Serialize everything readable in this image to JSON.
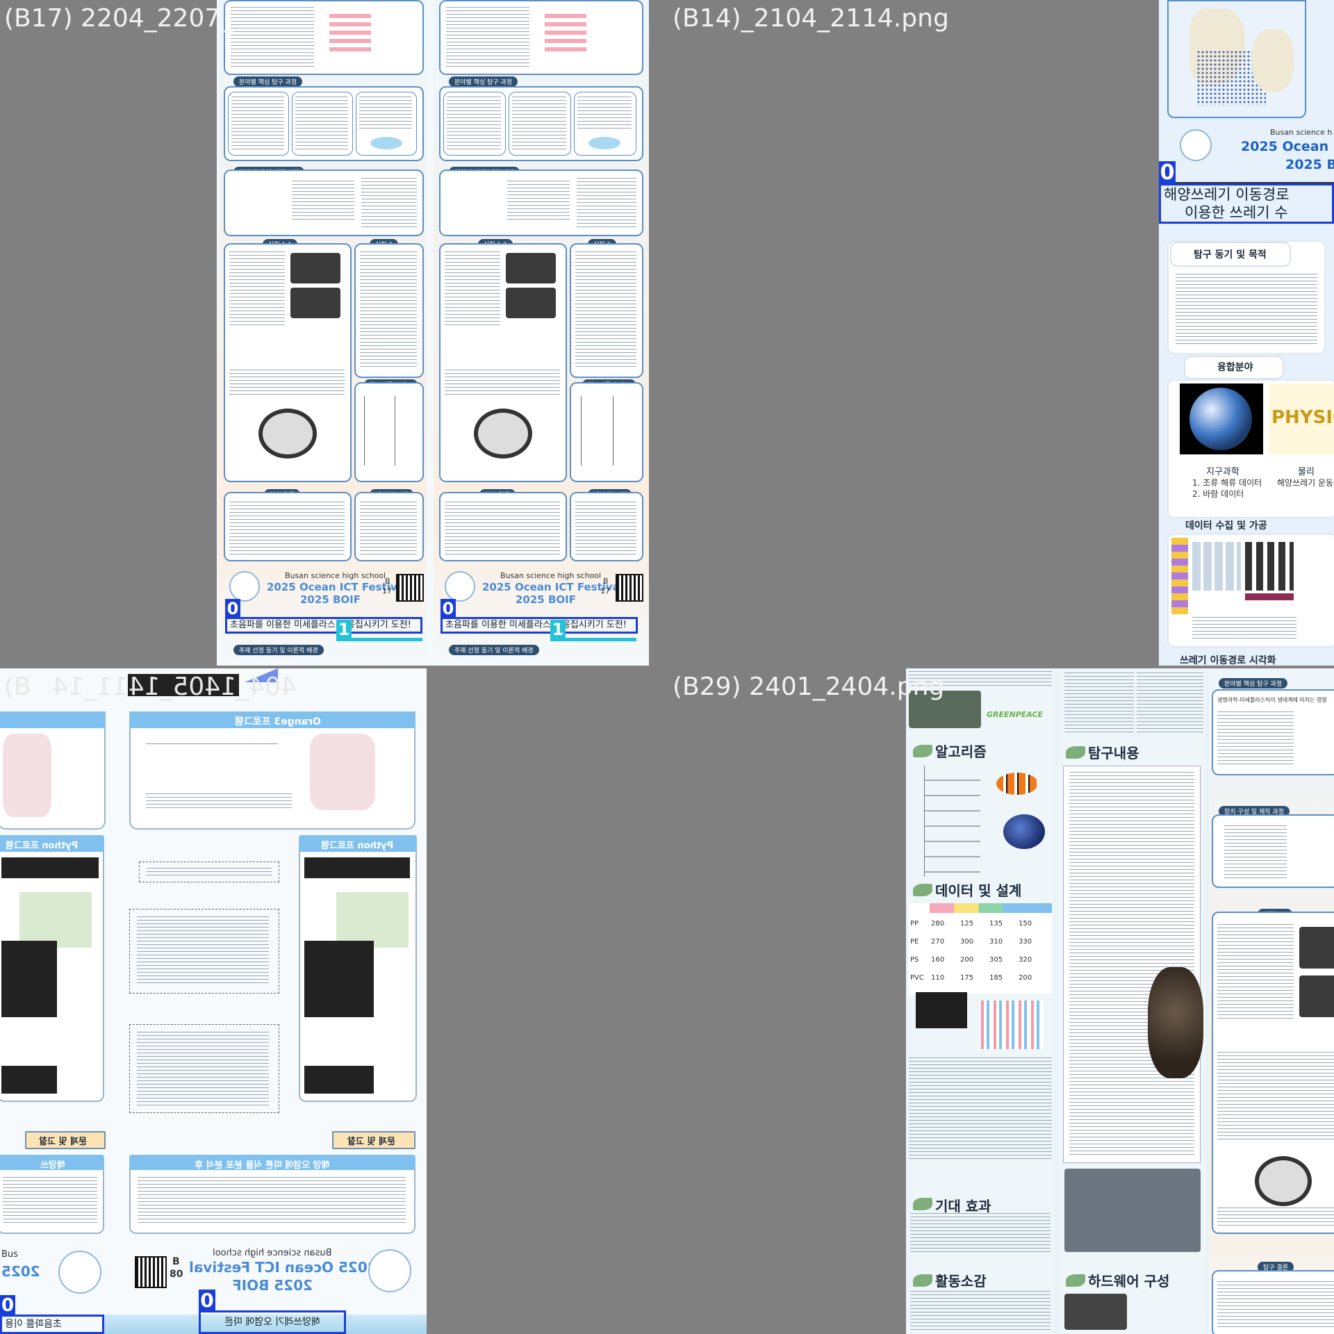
{
  "quadrants": {
    "tl": {
      "filename": "(B17) 2204_2207_",
      "school": "Busan science high school",
      "festival": "2025 Ocean ICT Festival",
      "boif": "2025 BOIF",
      "booth": "B",
      "booth_num": "17",
      "sections": [
        "분야별 핵심 탐구 과정",
        "장치 구성 및 제작 과정",
        "실험 1,2",
        "실험 3",
        "알고리즘 순서도",
        "탐구 결론",
        "제언 및 고찰",
        "주제 선정 동기 및 이론적 배경"
      ],
      "subpanels": [
        "생명과학-미세플라스틱이 생태계에 미치는 영향",
        "물리-미세플라스틱을 응집시키는 파동",
        "정보과학-응집장치 작동 방식 프로그래밍"
      ],
      "title_text": "초음파를 이용한 미세플라스틱 응집시키기 도전!",
      "title_text_cut": "초음파를 이용한 미세플라스",
      "title_text_tail": "응집시키기 도전!",
      "label0": "0",
      "label1": "1"
    },
    "tr": {
      "filename": "(B14)_2104_2114.png",
      "school": "Busan science h",
      "festival": "2025 Ocean I",
      "boif": "2025 B",
      "title_line1": "해양쓰레기 이동경로",
      "title_line2": "이용한 쓰레기 수",
      "section_motive": "탐구 동기 및 목적",
      "section_fusion": "융합분야",
      "earth_caption": "지구과학",
      "earth_items": [
        "1. 조류 해류 데이터",
        "2. 바람 데이터"
      ],
      "phys_caption": "물리",
      "phys_items": [
        "해양쓰레기 운동"
      ],
      "phys_word": "PHYSIC",
      "section_data": "데이터 수집 및 가공",
      "section_viz": "쓰레기 이동경로 시각화",
      "label0": "0"
    },
    "bl": {
      "filename": "(B",
      "filename_mirror": "404_1405_1411_14",
      "orange_title": "Orange3 프로그램",
      "python_title": "Python 프로그램",
      "problem_title": "문제 및 고찰",
      "expect_title": "해양 오염에 따른 식물 분포 분석 후",
      "left_title": "해양쓰",
      "school": "Busan science high school",
      "festival": "2025 Ocean ICT Festival",
      "boif": "2025 BOIF",
      "booth": "B",
      "booth_num": "80",
      "school_left": "Bus",
      "festival_left": "2025",
      "title_mirror_line1": "해양쓰레기 오염에 따른",
      "title_left": "초음파를 이용",
      "label0": "0"
    },
    "br": {
      "filename": "(B29) 2401_2404.png",
      "greenpeace": "GREENPEACE",
      "section_algo": "알고리즘",
      "section_explore": "탐구내용",
      "section_data": "데이터 및 설계",
      "section_expect": "기대 효과",
      "section_activity": "활동소감",
      "section_hw": "하드웨어 구성",
      "section_core": "분야별 핵심 탐구 과정",
      "section_device": "장치 구성 및 제작 과정",
      "section_exp": "실험 1,2",
      "section_conclusion": "탐구 결론",
      "core_sub": "생명과학-미세플라스틱이 생태계에 미치는 영향",
      "table_rows": [
        {
          "name": "PP",
          "v1": "280",
          "v2": "125",
          "v3": "135",
          "v4": "150"
        },
        {
          "name": "PE",
          "v1": "270",
          "v2": "300",
          "v3": "310",
          "v4": "330"
        },
        {
          "name": "PS",
          "v1": "160",
          "v2": "200",
          "v3": "305",
          "v4": "320"
        },
        {
          "name": "PVC",
          "v1": "110",
          "v2": "175",
          "v3": "185",
          "v4": "200"
        }
      ]
    }
  },
  "colors": {
    "background": "#808080",
    "annotation_blue": "#1a3fd6",
    "annotation_teal": "#22c2d8",
    "poster_border": "#5b8fc7",
    "festival_blue": "#4a8bd6"
  }
}
